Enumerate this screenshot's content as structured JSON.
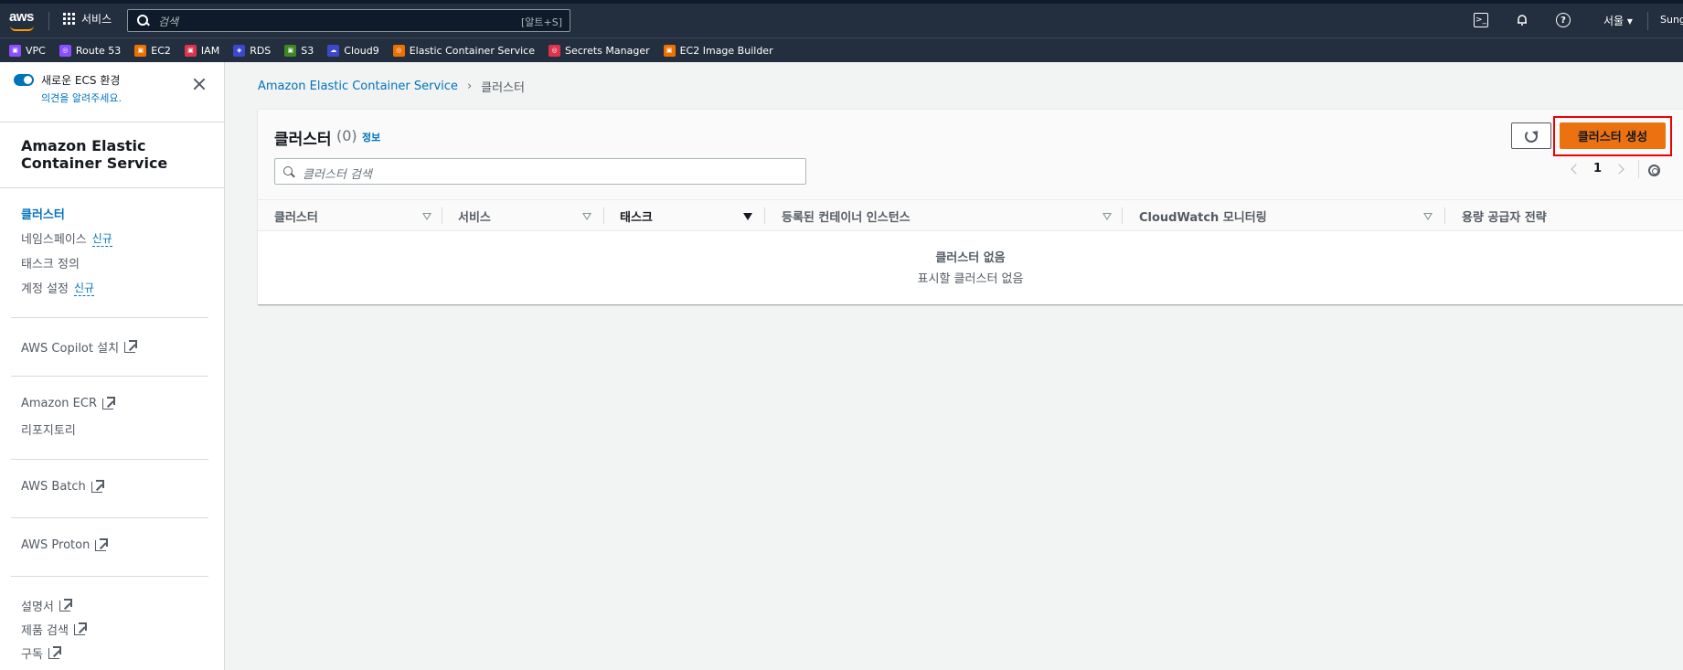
{
  "topnav": {
    "logo": "aws",
    "services_label": "서비스",
    "search_placeholder": "검색",
    "search_shortcut": "[알트+S]",
    "region": "서울 ▾",
    "user": "Sung"
  },
  "favorites": [
    {
      "label": "VPC",
      "color": "#8c4fff",
      "icon": "vpc-icon"
    },
    {
      "label": "Route 53",
      "color": "#8c4fff",
      "icon": "route53-icon"
    },
    {
      "label": "EC2",
      "color": "#ed7100",
      "icon": "ec2-icon"
    },
    {
      "label": "IAM",
      "color": "#dd344c",
      "icon": "iam-icon"
    },
    {
      "label": "RDS",
      "color": "#3b48cc",
      "icon": "rds-icon"
    },
    {
      "label": "S3",
      "color": "#3f8624",
      "icon": "s3-icon"
    },
    {
      "label": "Cloud9",
      "color": "#3b48cc",
      "icon": "cloud9-icon"
    },
    {
      "label": "Elastic Container Service",
      "color": "#ed7100",
      "icon": "ecs-icon"
    },
    {
      "label": "Secrets Manager",
      "color": "#dd344c",
      "icon": "secrets-manager-icon"
    },
    {
      "label": "EC2 Image Builder",
      "color": "#ed7100",
      "icon": "image-builder-icon"
    }
  ],
  "sidebar": {
    "toggle_label": "새로운 ECS 환경",
    "feedback_link": "의견을 알려주세요.",
    "title": "Amazon Elastic Container Service",
    "items": [
      {
        "label": "클러스터",
        "new": ""
      },
      {
        "label": "네임스페이스",
        "new": "신규"
      },
      {
        "label": "태스크 정의",
        "new": ""
      },
      {
        "label": "계정 설정",
        "new": "신규"
      }
    ],
    "external": {
      "copilot": "AWS Copilot 설치",
      "ecr": "Amazon ECR",
      "repositories": "리포지토리",
      "batch": "AWS Batch",
      "proton": "AWS Proton",
      "docs": "설명서",
      "product_search": "제품 검색",
      "subscribe": "구독"
    }
  },
  "breadcrumb": {
    "root": "Amazon Elastic Container Service",
    "current": "클러스터"
  },
  "clusters": {
    "title": "클러스터",
    "count": "(0)",
    "info": "정보",
    "search_placeholder": "클러스터 검색",
    "create_button": "클러스터 생성",
    "page": "1",
    "columns": [
      "클러스터",
      "서비스",
      "태스크",
      "등록된 컨테이너 인스턴스",
      "CloudWatch 모니터링",
      "용량 공급자 전략"
    ],
    "empty_title": "클러스터 없음",
    "empty_subtitle": "표시할 클러스터 없음"
  }
}
